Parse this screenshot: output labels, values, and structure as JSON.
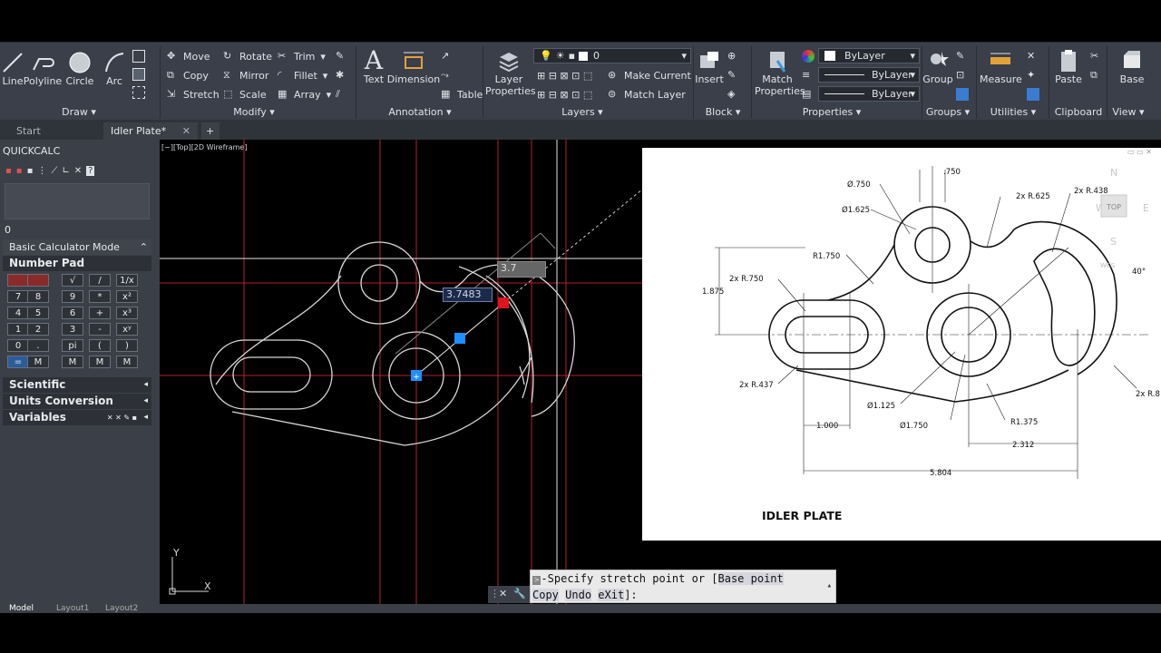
{
  "ribbon": {
    "draw": {
      "line": "Line",
      "polyline": "Polyline",
      "circle": "Circle",
      "arc": "Arc",
      "group": "Draw"
    },
    "modify": {
      "move": "Move",
      "rotate": "Rotate",
      "trim": "Trim",
      "copy": "Copy",
      "mirror": "Mirror",
      "fillet": "Fillet",
      "stretch": "Stretch",
      "scale": "Scale",
      "array": "Array",
      "group": "Modify"
    },
    "annotation": {
      "text": "Text",
      "dimension": "Dimension",
      "table": "Table",
      "group": "Annotation"
    },
    "layers": {
      "layer_properties": "Layer Properties",
      "current_layer": "0",
      "make_current": "Make Current",
      "match_layer": "Match Layer",
      "group": "Layers"
    },
    "block": {
      "insert": "Insert",
      "group": "Block"
    },
    "properties": {
      "match_properties": "Match Properties",
      "color": "ByLayer",
      "linetype": "ByLayer",
      "lineweight": "ByLayer",
      "group": "Properties"
    },
    "groups": {
      "group": "Group",
      "label": "Groups"
    },
    "utilities": {
      "measure": "Measure",
      "group": "Utilities"
    },
    "clipboard": {
      "paste": "Paste",
      "group": "Clipboard"
    },
    "view": {
      "base": "Base",
      "group": "View"
    }
  },
  "tabs": {
    "start": "Start",
    "drawing": "Idler Plate*",
    "add": "+"
  },
  "quickcalc": {
    "title": "QUICKCALC",
    "display_value": "0",
    "mode": "Basic Calculator Mode",
    "number_pad": "Number Pad",
    "keys": [
      [
        "",
        "",
        "√",
        "/",
        "1/x"
      ],
      [
        "7",
        "8",
        "9",
        "*",
        "x²"
      ],
      [
        "4",
        "5",
        "6",
        "+",
        "x³"
      ],
      [
        "1",
        "2",
        "3",
        "-",
        "xʸ"
      ],
      [
        "0",
        ".",
        "pi",
        "(",
        ")"
      ],
      [
        "=",
        "M",
        "M",
        "M",
        "M"
      ]
    ],
    "sections": [
      "Scientific",
      "Units Conversion",
      "Variables"
    ]
  },
  "viewport": {
    "label": "[−][Top][2D Wireframe]",
    "dim_length": "3.7483",
    "dim_angle": "3.7",
    "axis_x": "X",
    "axis_y": "Y"
  },
  "command": {
    "line1_prefix": "-Specify stretch point or [",
    "opt_base": "Base point",
    "opt_copy": "Copy",
    "opt_undo": "Undo",
    "opt_exit": "eXit",
    "line2_suffix": "]:"
  },
  "reference": {
    "title": "IDLER PLATE",
    "dims": {
      "d750": "Ø.750",
      "d1625": "Ø1.625",
      "top750": ".750",
      "r625": "2x R.625",
      "r438": "2x R.438",
      "r1750": "R1.750",
      "r750": "2x R.750",
      "h1875": "1.875",
      "r437": "2x R.437",
      "d1125": "Ø1.125",
      "d1750": "Ø1.750",
      "r1375": "R1.375",
      "w1000": "1.000",
      "w2312": "2.312",
      "w5804": "5.804",
      "ang40": "40°",
      "r8": "2x R.8"
    },
    "viewcube": {
      "n": "N",
      "w": "W",
      "e": "E",
      "s": "S",
      "top": "TOP",
      "wcs": "WCS"
    }
  },
  "statusbar": {
    "model": "Model",
    "layout1": "Layout1",
    "layout2": "Layout2"
  },
  "colors": {
    "ribbon": "#3a3f49",
    "panel": "#3b4048",
    "grid_red": "#b3222a",
    "ucs_blue": "#1e90ff",
    "grip_red": "#e0141e"
  }
}
